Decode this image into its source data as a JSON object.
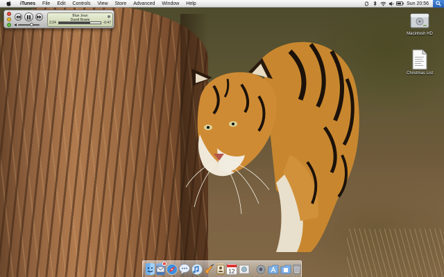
{
  "menubar": {
    "app_name": "iTunes",
    "menus": [
      "File",
      "Edit",
      "Controls",
      "View",
      "Store",
      "Advanced",
      "Window",
      "Help"
    ],
    "clock": "Sun 20:56",
    "status_icons": [
      "sync-icon",
      "bluetooth-icon",
      "wifi-icon",
      "volume-icon",
      "battery-icon"
    ]
  },
  "mini_player": {
    "track_title": "Blue Jean",
    "track_artist": "David Bowie",
    "elapsed": "2:24",
    "remaining": "-0:47",
    "progress": 0.75,
    "volume": 0.55
  },
  "desktop_icons": [
    {
      "label": "Macintosh HD",
      "icon": "hard-drive-icon"
    },
    {
      "label": "Christmas List",
      "icon": "document-icon"
    }
  ],
  "dock": {
    "mail_badge": "1",
    "items": [
      "finder-icon",
      "mail-icon",
      "safari-icon",
      "ichat-icon",
      "itunes-icon",
      "garageband-icon",
      "address-book-icon",
      "ical-icon",
      "preview-icon",
      "system-preferences-icon",
      "applications-folder-icon",
      "documents-folder-icon",
      "trash-icon"
    ]
  },
  "colors": {
    "menubar_bg": "#e8e8e8",
    "lcd_bg": "#dfe6c8",
    "badge_red": "#e0251b"
  }
}
